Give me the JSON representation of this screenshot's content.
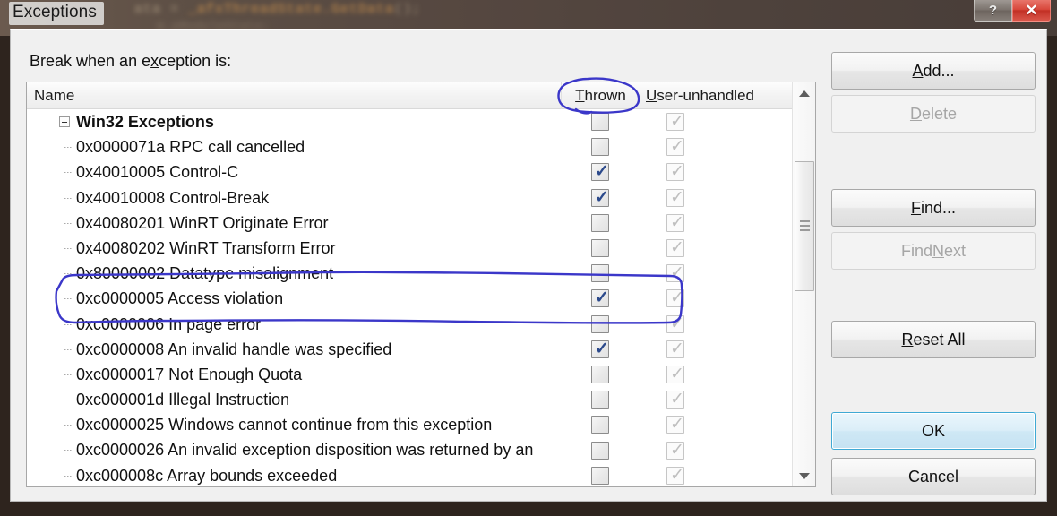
{
  "window": {
    "title": "Exceptions",
    "help_button": "?",
    "close_button": "✕",
    "backdrop_code": "ata = _afxThreadState.GetData();",
    "backdrop_code2": "m_pModuleState;"
  },
  "dialog": {
    "prompt": "Break when an exception is:",
    "prompt_accel": "x"
  },
  "list": {
    "columns": [
      {
        "label": "Name",
        "accel": ""
      },
      {
        "label": "Thrown",
        "accel": "T"
      },
      {
        "label": "User-unhandled",
        "accel": "U"
      }
    ],
    "rows": [
      {
        "name": "Win32 Exceptions",
        "group": true,
        "thrown": false,
        "unhandled": true
      },
      {
        "name": "0x0000071a RPC call cancelled",
        "group": false,
        "thrown": false,
        "unhandled": true
      },
      {
        "name": "0x40010005 Control-C",
        "group": false,
        "thrown": true,
        "unhandled": true
      },
      {
        "name": "0x40010008 Control-Break",
        "group": false,
        "thrown": true,
        "unhandled": true
      },
      {
        "name": "0x40080201 WinRT Originate Error",
        "group": false,
        "thrown": false,
        "unhandled": true
      },
      {
        "name": "0x40080202 WinRT Transform Error",
        "group": false,
        "thrown": false,
        "unhandled": true
      },
      {
        "name": "0x80000002 Datatype misalignment",
        "group": false,
        "thrown": false,
        "unhandled": true
      },
      {
        "name": "0xc0000005 Access violation",
        "group": false,
        "thrown": true,
        "unhandled": true
      },
      {
        "name": "0xc0000006 In page error",
        "group": false,
        "thrown": false,
        "unhandled": true
      },
      {
        "name": "0xc0000008 An invalid handle was specified",
        "group": false,
        "thrown": true,
        "unhandled": true
      },
      {
        "name": "0xc0000017 Not Enough Quota",
        "group": false,
        "thrown": false,
        "unhandled": true
      },
      {
        "name": "0xc000001d Illegal Instruction",
        "group": false,
        "thrown": false,
        "unhandled": true
      },
      {
        "name": "0xc0000025 Windows cannot continue from this exception",
        "group": false,
        "thrown": false,
        "unhandled": true
      },
      {
        "name": "0xc0000026 An invalid exception disposition was returned by an",
        "group": false,
        "thrown": false,
        "unhandled": true
      },
      {
        "name": "0xc000008c Array bounds exceeded",
        "group": false,
        "thrown": false,
        "unhandled": true
      }
    ],
    "checkmark_glyph": "✓"
  },
  "buttons": {
    "add": {
      "label": "Add...",
      "accel": "A",
      "enabled": true
    },
    "delete": {
      "label": "Delete",
      "accel": "D",
      "enabled": false
    },
    "find": {
      "label": "Find...",
      "accel": "F",
      "enabled": true
    },
    "find_next": {
      "label": "Find Next",
      "accel": "N",
      "enabled": false
    },
    "reset_all": {
      "label": "Reset All",
      "accel": "R",
      "enabled": true
    },
    "ok": {
      "label": "OK",
      "accel": "",
      "enabled": true
    },
    "cancel": {
      "label": "Cancel",
      "accel": "",
      "enabled": true
    }
  },
  "annotations": {
    "ink_color": "#3b37c9",
    "shapes": [
      {
        "name": "thrown-header-circle",
        "type": "ellipse"
      },
      {
        "name": "access-violation-row-box",
        "type": "rectangle"
      }
    ]
  }
}
